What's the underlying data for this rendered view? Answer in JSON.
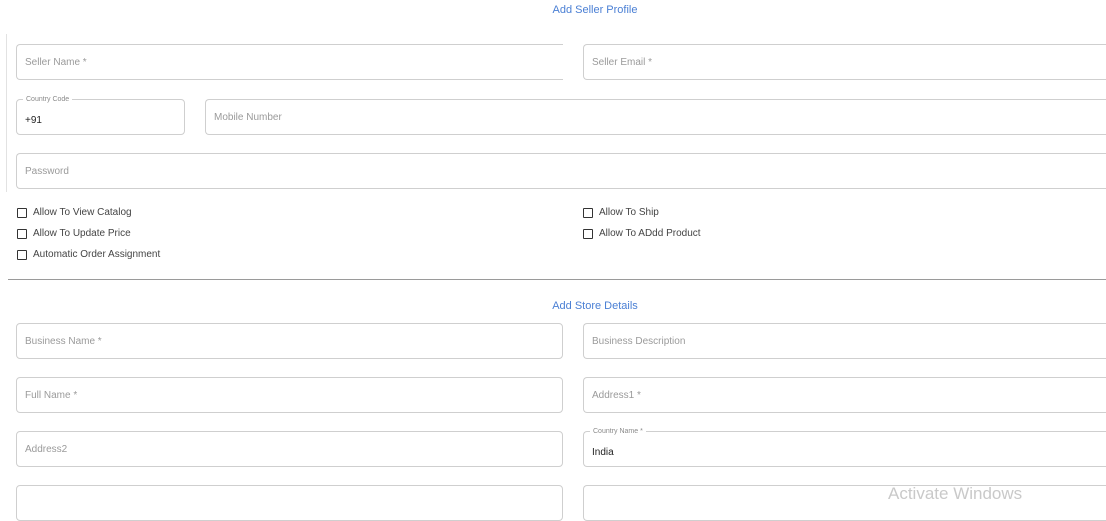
{
  "seller_profile": {
    "title": "Add Seller Profile",
    "seller_name": {
      "placeholder": "Seller Name *",
      "value": ""
    },
    "seller_email": {
      "placeholder": "Seller Email *",
      "value": ""
    },
    "country_code": {
      "label": "Country Code",
      "value": "+91"
    },
    "mobile_number": {
      "placeholder": "Mobile Number",
      "value": ""
    },
    "password": {
      "placeholder": "Password",
      "value": ""
    },
    "permissions": [
      {
        "label": "Allow To View Catalog",
        "checked": false
      },
      {
        "label": "Allow To Update Price",
        "checked": false
      },
      {
        "label": "Automatic Order Assignment",
        "checked": false
      },
      {
        "label": "Allow To Ship",
        "checked": false
      },
      {
        "label": "Allow To ADdd Product",
        "checked": false
      }
    ]
  },
  "store_details": {
    "title": "Add Store Details",
    "business_name": {
      "placeholder": "Business Name *",
      "value": ""
    },
    "business_description": {
      "placeholder": "Business Description",
      "value": ""
    },
    "full_name": {
      "placeholder": "Full Name *",
      "value": ""
    },
    "address1": {
      "placeholder": "Address1 *",
      "value": ""
    },
    "address2": {
      "placeholder": "Address2",
      "value": ""
    },
    "country_name": {
      "label": "Country Name *",
      "value": "India"
    }
  },
  "watermark": "Activate Windows"
}
